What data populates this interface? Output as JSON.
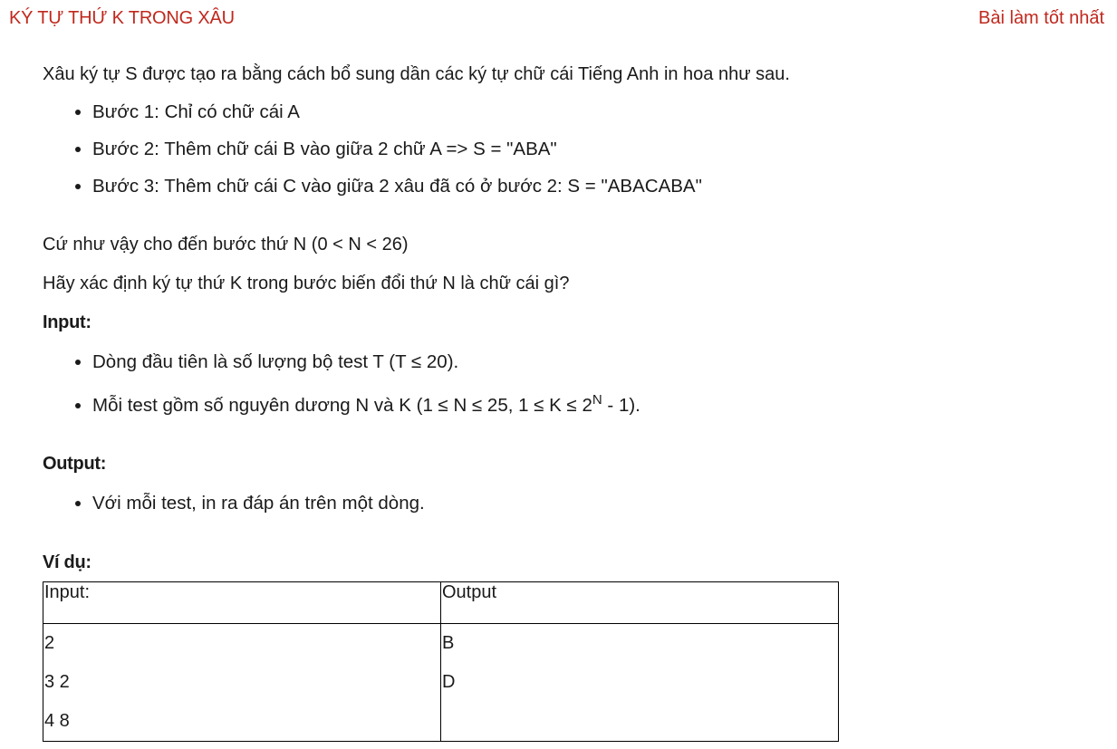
{
  "header": {
    "title": "KÝ TỰ THỨ K TRONG XÂU",
    "best_link": "Bài làm tốt nhất"
  },
  "intro": "Xâu ký tự S được tạo ra bằng cách bổ sung dần các ký tự chữ cái Tiếng Anh in hoa như sau.",
  "steps": [
    "Bước 1: Chỉ có chữ cái A",
    "Bước 2: Thêm chữ cái B vào giữa 2 chữ A => S = \"ABA\"",
    "Bước 3: Thêm chữ cái C vào giữa 2 xâu đã có ở bước 2: S = \"ABACABA\""
  ],
  "continue_text": "Cứ như vậy cho đến bước thứ N (0 < N < 26)",
  "question": "Hãy xác định ký tự thứ K trong bước biến đổi thứ N là chữ cái gì?",
  "input_section": {
    "heading": "Input:",
    "items": [
      "Dòng đầu tiên là số lượng bộ test T (T ≤ 20).",
      "Mỗi test gồm số nguyên dương N và K (1 ≤ N ≤ 25, 1 ≤ K ≤ 2"
    ],
    "sup": "N",
    "item2_tail": " - 1)."
  },
  "output_section": {
    "heading": "Output:",
    "items": [
      "Với mỗi test, in ra đáp án trên một dòng."
    ]
  },
  "example": {
    "heading": "Ví dụ:",
    "col_input": "Input:",
    "col_output": "Output",
    "input_lines": [
      "2",
      "3 2",
      "4 8"
    ],
    "output_lines": [
      "B",
      "D"
    ]
  }
}
